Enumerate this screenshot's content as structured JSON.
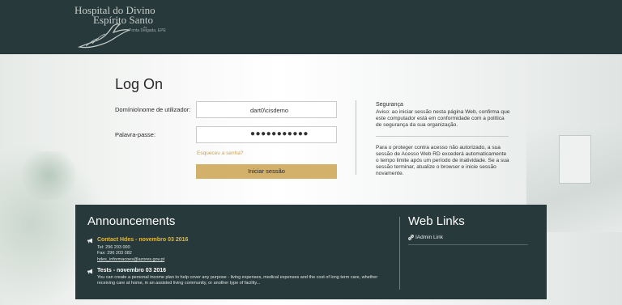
{
  "header": {
    "logo": {
      "line1": "Hospital do Divino",
      "line2": "Espírito Santo",
      "line_de": "de",
      "line3": "Ponta Delgada, EPE"
    }
  },
  "logon": {
    "title": "Log On",
    "username_label": "Domínio\\nome de utilizador:",
    "username_value": "dart0\\cisdemo",
    "password_label": "Palavra-passe:",
    "password_value": "●●●●●●●●●●●",
    "forgot_link": "Esqueceu a senha?",
    "submit_label": "Iniciar sessão"
  },
  "security": {
    "title": "Segurança",
    "notice": "Aviso: ao iniciar sessão nesta página Web, confirma que este computador está em conformidade com a política de segurança da sua organização.",
    "timeout": "Para o proteger contra acesso não autorizado, a sua sessão de Acesso Web RD excederá automaticamente o tempo limite após um período de inatividade. Se a sua sessão terminar, atualize o browser e inicie sessão novamente."
  },
  "announcements": {
    "title": "Announcements",
    "items": [
      {
        "heading": "Contact Hdes - novembro 03 2016",
        "lines": [
          "Tel: 296 203 000",
          "Fax: 296 203 082"
        ],
        "email": "hdes_informacoes@azores.gov.pt"
      },
      {
        "heading": "Tests - novembro 03 2016",
        "lines": [
          "You can create a personal income plan to help cover any purpose - living expenses, medical expenses and the cost of long term care, whether",
          "receiving care at home, in an assisted living community, or another type of facility..."
        ]
      }
    ]
  },
  "web_links": {
    "title": "Web Links",
    "items": [
      {
        "label": "IAdmin Link"
      }
    ]
  },
  "colors": {
    "header_bg": "#27393a",
    "accent_gold": "#d3b16a",
    "link_gold": "#c8a25a",
    "announcement_head": "#e0b94a"
  },
  "icons": {
    "announcement": "megaphone-icon",
    "web_link": "link-icon"
  }
}
